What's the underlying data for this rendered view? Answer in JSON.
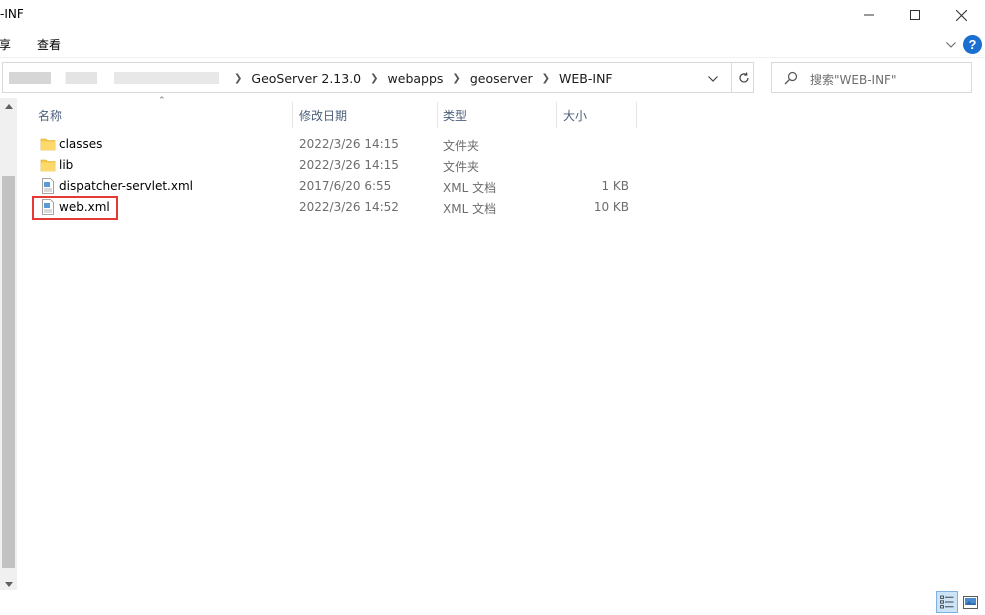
{
  "window": {
    "title": "-INF"
  },
  "ribbon": {
    "share_label": "享",
    "view_label": "查看"
  },
  "address": {
    "crumbs": [
      "GeoServer 2.13.0",
      "webapps",
      "geoserver",
      "WEB-INF"
    ]
  },
  "search": {
    "placeholder": "搜索\"WEB-INF\""
  },
  "columns": {
    "name": "名称",
    "date": "修改日期",
    "type": "类型",
    "size": "大小"
  },
  "files": [
    {
      "name": "classes",
      "date": "2022/3/26 14:15",
      "type": "文件夹",
      "size": "",
      "icon": "folder-icon"
    },
    {
      "name": "lib",
      "date": "2022/3/26 14:15",
      "type": "文件夹",
      "size": "",
      "icon": "folder-icon"
    },
    {
      "name": "dispatcher-servlet.xml",
      "date": "2017/6/20 6:55",
      "type": "XML 文档",
      "size": "1 KB",
      "icon": "xml-file-icon"
    },
    {
      "name": "web.xml",
      "date": "2022/3/26 14:52",
      "type": "XML 文档",
      "size": "10 KB",
      "icon": "xml-file-icon"
    }
  ],
  "colors": {
    "accent": "#1a6fd1",
    "highlight": "#e53935",
    "folder": "#f7c948"
  }
}
